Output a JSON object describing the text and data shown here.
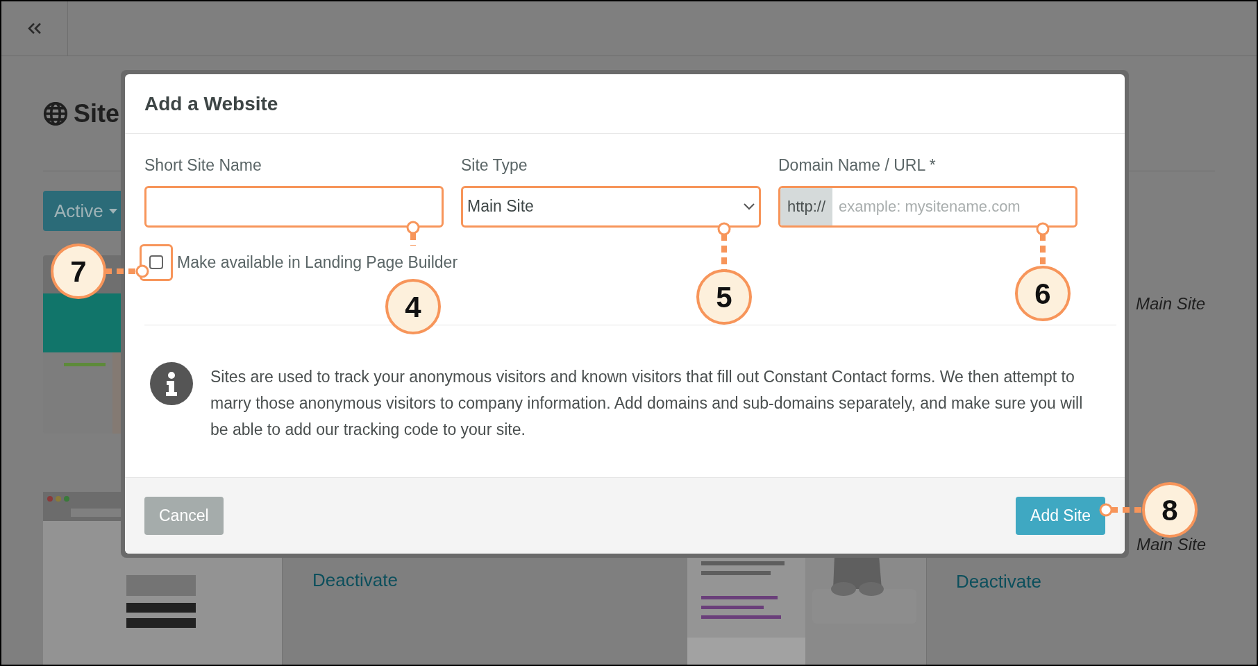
{
  "page": {
    "title": "Site",
    "filter_button": "Active",
    "cards": [
      {
        "kind": "picture"
      },
      {
        "kind": "picture"
      },
      {
        "kind": "picture"
      }
    ],
    "site_types": [
      "Main Site",
      "Main Site"
    ],
    "links": [
      "Deactivate",
      "Deactivate"
    ]
  },
  "modal": {
    "title": "Add a Website",
    "fields": [
      {
        "kind": "text",
        "label": "Short Site Name"
      },
      {
        "kind": "select",
        "label": "Site Type",
        "value": "Main Site"
      },
      {
        "kind": "url",
        "label": "Domain Name / URL *",
        "prefix": "http://",
        "placeholder": "example: mysitename.com"
      }
    ],
    "checkbox": {
      "label": "Make available in Landing Page Builder",
      "checked": false
    },
    "info": "Sites are used to track your anonymous visitors and known visitors that fill out Constant Contact forms. We then attempt to marry those anonymous visitors to company information. Add domains and sub-domains separately, and make sure you will be able to add our tracking code to your site.",
    "buttons": [
      {
        "kind": "secondary",
        "label": "Cancel"
      },
      {
        "kind": "primary",
        "label": "Add Site"
      }
    ]
  },
  "callouts": [
    {
      "label": "7"
    },
    {
      "label": "4"
    },
    {
      "label": "5"
    },
    {
      "label": "6"
    },
    {
      "label": "8"
    }
  ]
}
